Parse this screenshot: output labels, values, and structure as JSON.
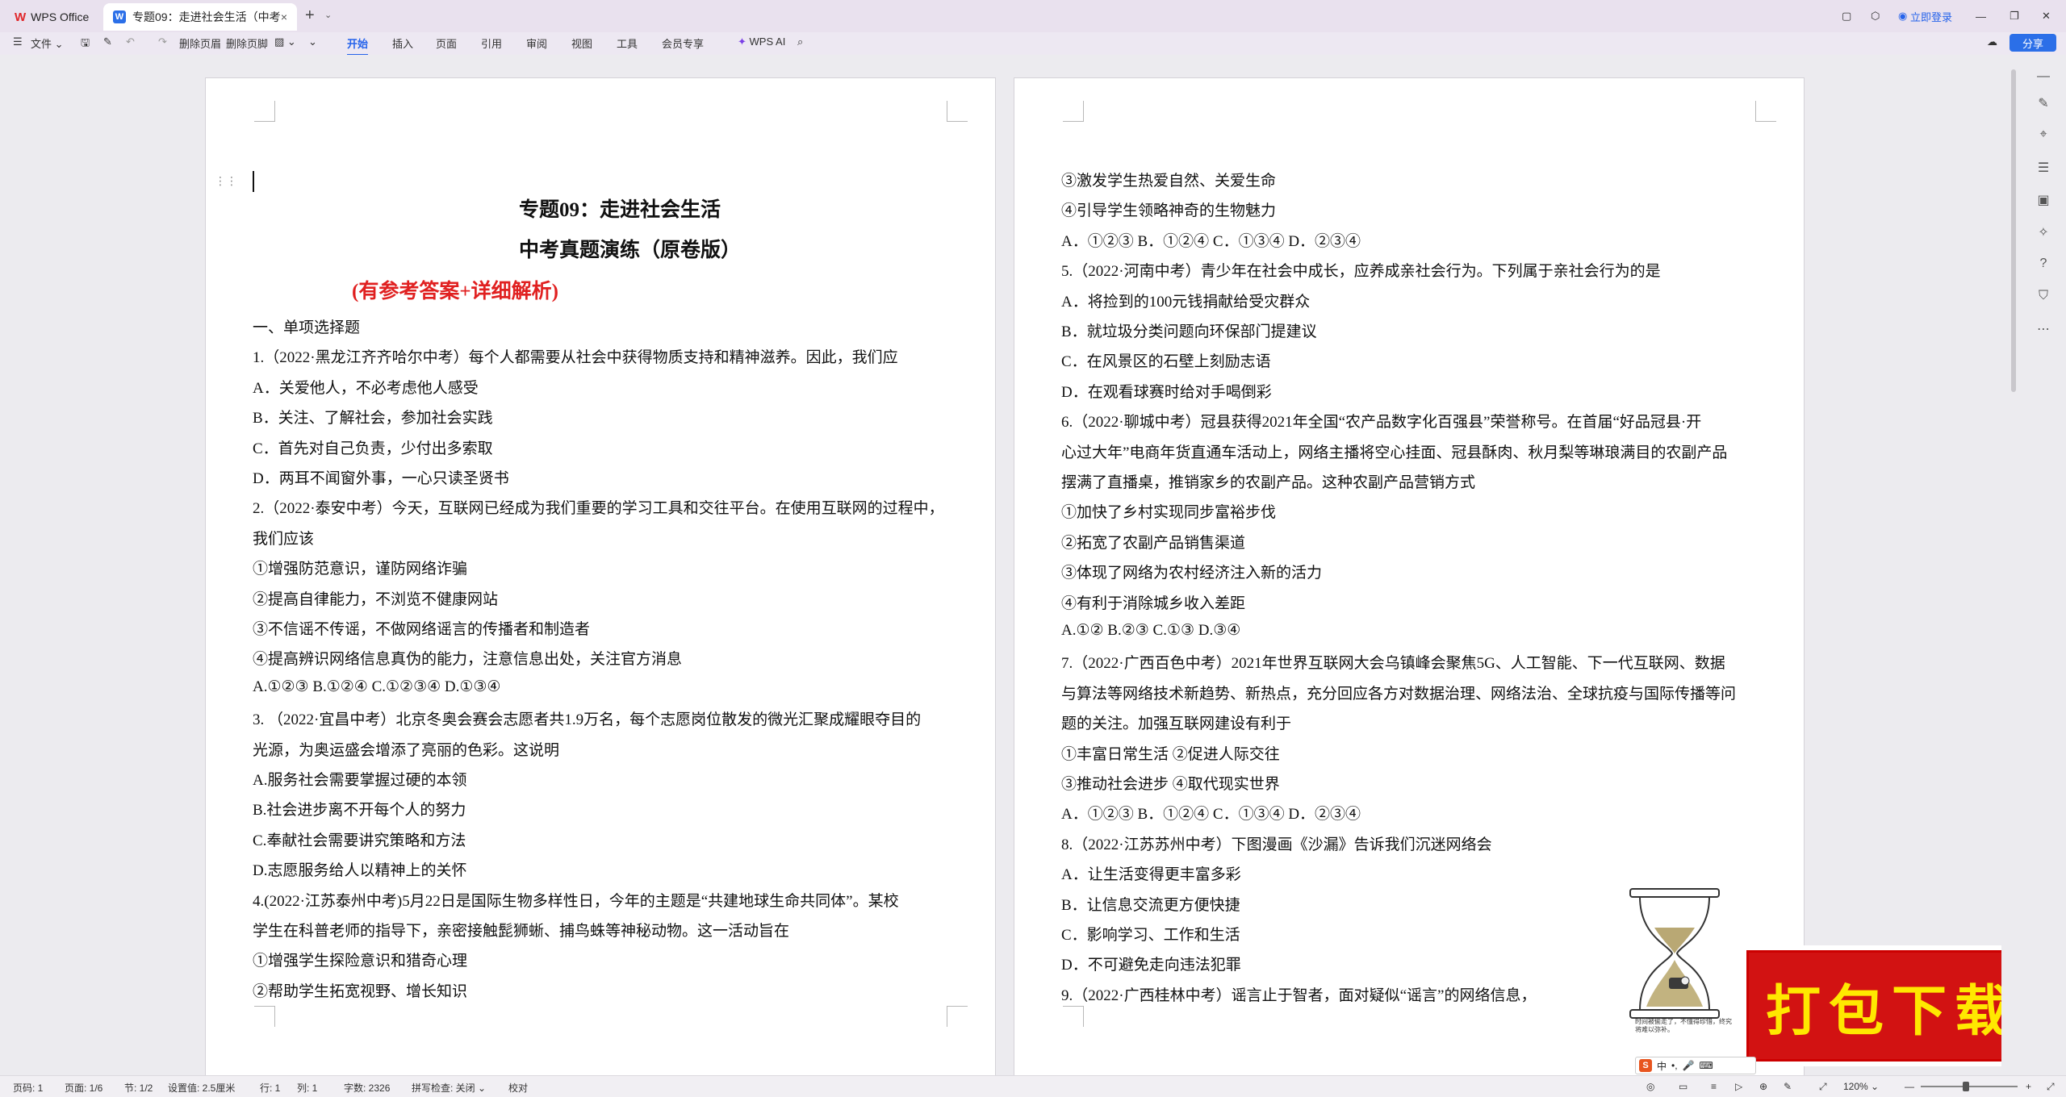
{
  "titlebar": {
    "home_tab": "WPS Office",
    "doc_tab": "专题09：走进社会生活（中考",
    "login": "立即登录"
  },
  "toolbar": {
    "file": "文件",
    "delete_header": "删除页眉",
    "delete_footer": "删除页脚",
    "tabs": [
      "开始",
      "插入",
      "页面",
      "引用",
      "审阅",
      "视图",
      "工具",
      "会员专享"
    ],
    "wps_ai": "WPS AI",
    "share": "分享"
  },
  "page1": {
    "title": "专题09：走进社会生活",
    "subtitle": "中考真题演练（原卷版）",
    "note": "(有参考答案+详细解析)",
    "lines": [
      "一、单项选择题",
      "1.（2022·黑龙江齐齐哈尔中考）每个人都需要从社会中获得物质支持和精神滋养。因此，我们应",
      "A．关爱他人，不必考虑他人感受",
      "B．关注、了解社会，参加社会实践",
      "C．首先对自己负责，少付出多索取",
      "D．两耳不闻窗外事，一心只读圣贤书",
      "2.（2022·泰安中考）今天，互联网已经成为我们重要的学习工具和交往平台。在使用互联网的过程中，",
      "我们应该",
      "①增强防范意识，谨防网络诈骗",
      "②提高自律能力，不浏览不健康网站",
      "③不信谣不传谣，不做网络谣言的传播者和制造者",
      "④提高辨识网络信息真伪的能力，注意信息出处，关注官方消息",
      "A.①②③              B.①②④                   C.①②③④                    D.①③④",
      "3.  （2022·宜昌中考）北京冬奥会赛会志愿者共1.9万名，每个志愿岗位散发的微光汇聚成耀眼夺目的",
      "光源，为奥运盛会增添了亮丽的色彩。这说明",
      "A.服务社会需要掌握过硬的本领",
      "B.社会进步离不开每个人的努力",
      "C.奉献社会需要讲究策略和方法",
      "D.志愿服务给人以精神上的关怀",
      "4.(2022·江苏泰州中考)5月22日是国际生物多样性日，今年的主题是“共建地球生命共同体”。某校",
      "学生在科普老师的指导下，亲密接触髭狮蜥、捕鸟蛛等神秘动物。这一活动旨在",
      "①增强学生探险意识和猎奇心理",
      "②帮助学生拓宽视野、增长知识"
    ]
  },
  "page2": {
    "lines": [
      "③激发学生热爱自然、关爱生命",
      "④引导学生领略神奇的生物魅力",
      "A．①②③                    B．①②④                    C．①③④                    D．②③④",
      "5.（2022·河南中考）青少年在社会中成长，应养成亲社会行为。下列属于亲社会行为的是",
      "A．将捡到的100元钱捐献给受灾群众",
      "B．就垃圾分类问题向环保部门提建议",
      "C．在风景区的石壁上刻励志语",
      "D．在观看球赛时给对手喝倒彩",
      "6.（2022·聊城中考）冠县获得2021年全国“农产品数字化百强县”荣誉称号。在首届“好品冠县·开",
      "心过大年”电商年货直通车活动上，网络主播将空心挂面、冠县酥肉、秋月梨等琳琅满目的农副产品",
      "摆满了直播桌，推销家乡的农副产品。这种农副产品营销方式",
      "①加快了乡村实现同步富裕步伐",
      "②拓宽了农副产品销售渠道",
      "③体现了网络为农村经济注入新的活力",
      "④有利于消除城乡收入差距",
      "A.①②                    B.②③                    C.①③                    D.③④",
      "7.（2022·广西百色中考）2021年世界互联网大会乌镇峰会聚焦5G、人工智能、下一代互联网、数据",
      "与算法等网络技术新趋势、新热点，充分回应各方对数据治理、网络法治、全球抗疫与国际传播等问",
      "题的关注。加强互联网建设有利于",
      "①丰富日常生活                                                ②促进人际交往",
      "③推动社会进步                                                ④取代现实世界",
      "A．①②③                    B．①②④                    C．①③④                    D．②③④",
      "8.（2022·江苏苏州中考）下图漫画《沙漏》告诉我们沉迷网络会",
      "A．让生活变得更丰富多彩",
      "B．让信息交流更方便快捷",
      "C．影响学习、工作和生活",
      "D．不可避免走向违法犯罪",
      "9.（2022·广西桂林中考）谣言止于智者，面对疑似“谣言”的网络信息，"
    ],
    "cartoon_caption": "时间被偷走了，不懂得珍惜，终究将难以弥补。",
    "banner": "打包下载"
  },
  "statusbar": {
    "page_code": "页码: 1",
    "page": "页面: 1/6",
    "section": "节: 1/2",
    "setting": "设置值: 2.5厘米",
    "row": "行: 1",
    "col": "列: 1",
    "words": "字数: 2326",
    "spell": "拼写检查: 关闭",
    "proof": "校对",
    "zoom": "120%"
  },
  "ime": {
    "mode": "中"
  }
}
